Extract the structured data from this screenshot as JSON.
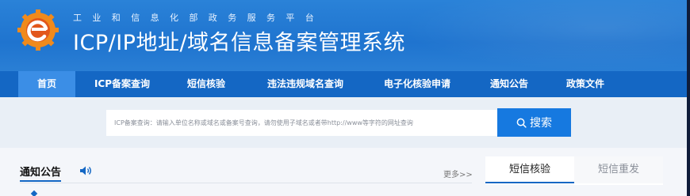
{
  "header": {
    "subtitle": "工业和信息化部政务服务平台",
    "title": "ICP/IP地址/域名信息备案管理系统",
    "logo_icon": "gear-e-logo"
  },
  "nav": {
    "items": [
      {
        "label": "首页",
        "active": true
      },
      {
        "label": "ICP备案查询",
        "active": false
      },
      {
        "label": "短信核验",
        "active": false
      },
      {
        "label": "违法违规域名查询",
        "active": false
      },
      {
        "label": "电子化核验申请",
        "active": false
      },
      {
        "label": "通知公告",
        "active": false
      },
      {
        "label": "政策文件",
        "active": false
      }
    ]
  },
  "search": {
    "placeholder": "ICP备案查询：请输入单位名称或域名或备案号查询，请勿使用子域名或者带http://www等字符的网址查询",
    "button_label": "搜索",
    "button_icon": "search-icon"
  },
  "notices": {
    "heading": "通知公告",
    "speaker_icon": "speaker-icon",
    "more_label": "更多>>"
  },
  "right_tabs": [
    {
      "label": "短信核验",
      "active": true
    },
    {
      "label": "短信重发",
      "active": false
    }
  ],
  "colors": {
    "header_blue": "#2a82d8",
    "nav_blue": "#1467c4",
    "nav_active": "#3b8ee6",
    "button_blue": "#1679e0"
  }
}
